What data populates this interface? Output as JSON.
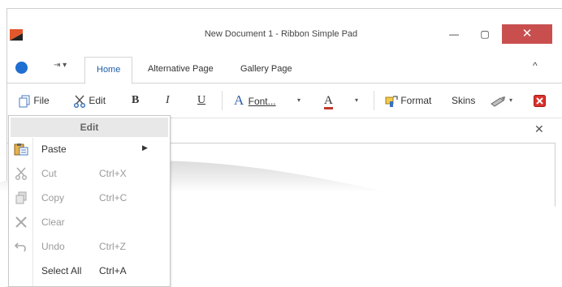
{
  "window": {
    "title": "New Document 1 - Ribbon Simple Pad",
    "minimize_glyph": "—",
    "maximize_glyph": "▢",
    "close_glyph": "✕"
  },
  "ribbon": {
    "tabs": [
      {
        "label": "Home",
        "active": true
      },
      {
        "label": "Alternative Page",
        "active": false
      },
      {
        "label": "Gallery Page",
        "active": false
      }
    ],
    "qat_glyph": "⇥ ▾",
    "collapse_glyph": "^",
    "items": {
      "file": "File",
      "edit": "Edit",
      "bold": "B",
      "italic": "I",
      "underline": "U",
      "font": "Font...",
      "font_color": "A",
      "format": "Format",
      "skins": "Skins"
    },
    "dropdown_glyph": "▾"
  },
  "document": {
    "close_glyph": "✕"
  },
  "menu": {
    "header": "Edit",
    "items": [
      {
        "label": "Paste",
        "shortcut": "",
        "enabled": true,
        "submenu": true,
        "icon": "paste-icon"
      },
      {
        "label": "Cut",
        "shortcut": "Ctrl+X",
        "enabled": false,
        "icon": "cut-icon"
      },
      {
        "label": "Copy",
        "shortcut": "Ctrl+C",
        "enabled": false,
        "icon": "copy-icon"
      },
      {
        "label": "Clear",
        "shortcut": "",
        "enabled": false,
        "icon": "clear-icon"
      },
      {
        "label": "Undo",
        "shortcut": "Ctrl+Z",
        "enabled": false,
        "icon": "undo-icon"
      },
      {
        "label": "Select All",
        "shortcut": "Ctrl+A",
        "enabled": true,
        "icon": ""
      }
    ],
    "submenu_glyph": "▶"
  },
  "colors": {
    "accent": "#1f6fd1",
    "close_red": "#c94f4f",
    "font_color_red": "#c0392b"
  }
}
